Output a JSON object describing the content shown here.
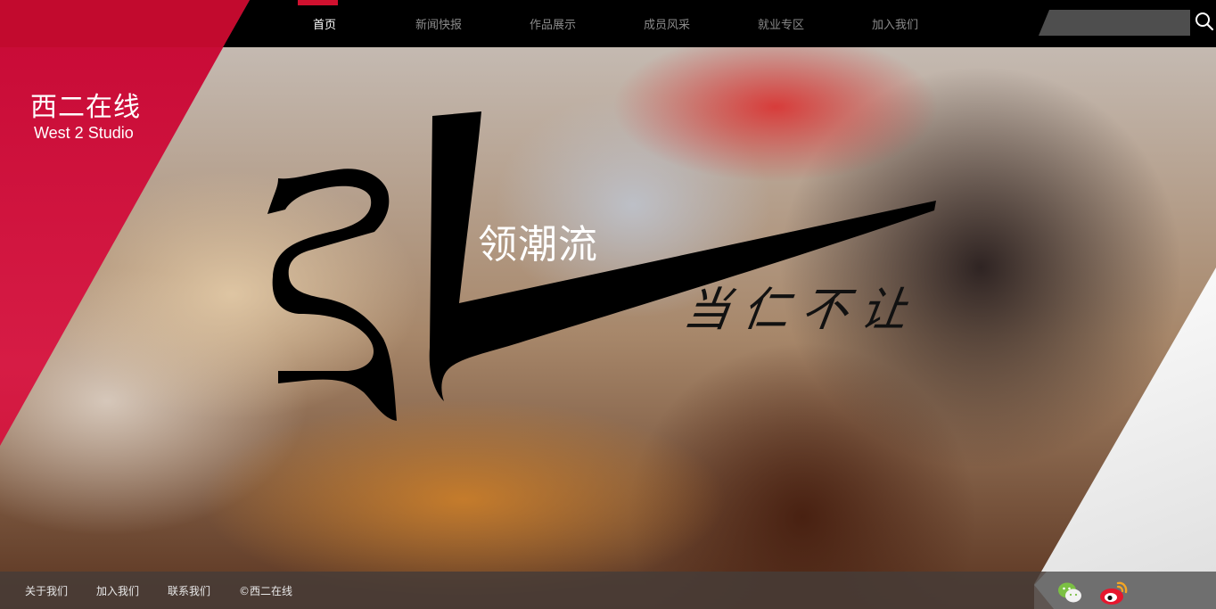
{
  "site": {
    "name_cn": "西二在线",
    "name_en": "West 2 Studio"
  },
  "nav": {
    "items": [
      {
        "label": "首页",
        "active": true
      },
      {
        "label": "新闻快报",
        "active": false
      },
      {
        "label": "作品展示",
        "active": false
      },
      {
        "label": "成员风采",
        "active": false
      },
      {
        "label": "就业专区",
        "active": false
      },
      {
        "label": "加入我们",
        "active": false
      }
    ],
    "search_placeholder": ""
  },
  "hero": {
    "slogan": "领潮流",
    "motto": "当仁不让"
  },
  "footer": {
    "links": [
      "关于我们",
      "加入我们",
      "联系我们"
    ],
    "copyright": "©西二在线"
  },
  "colors": {
    "brand_red": "#d0112f",
    "nav_bg": "#000000",
    "footer_bg": "#463c37"
  },
  "icons": [
    "search-icon",
    "wechat-icon",
    "weibo-icon"
  ]
}
